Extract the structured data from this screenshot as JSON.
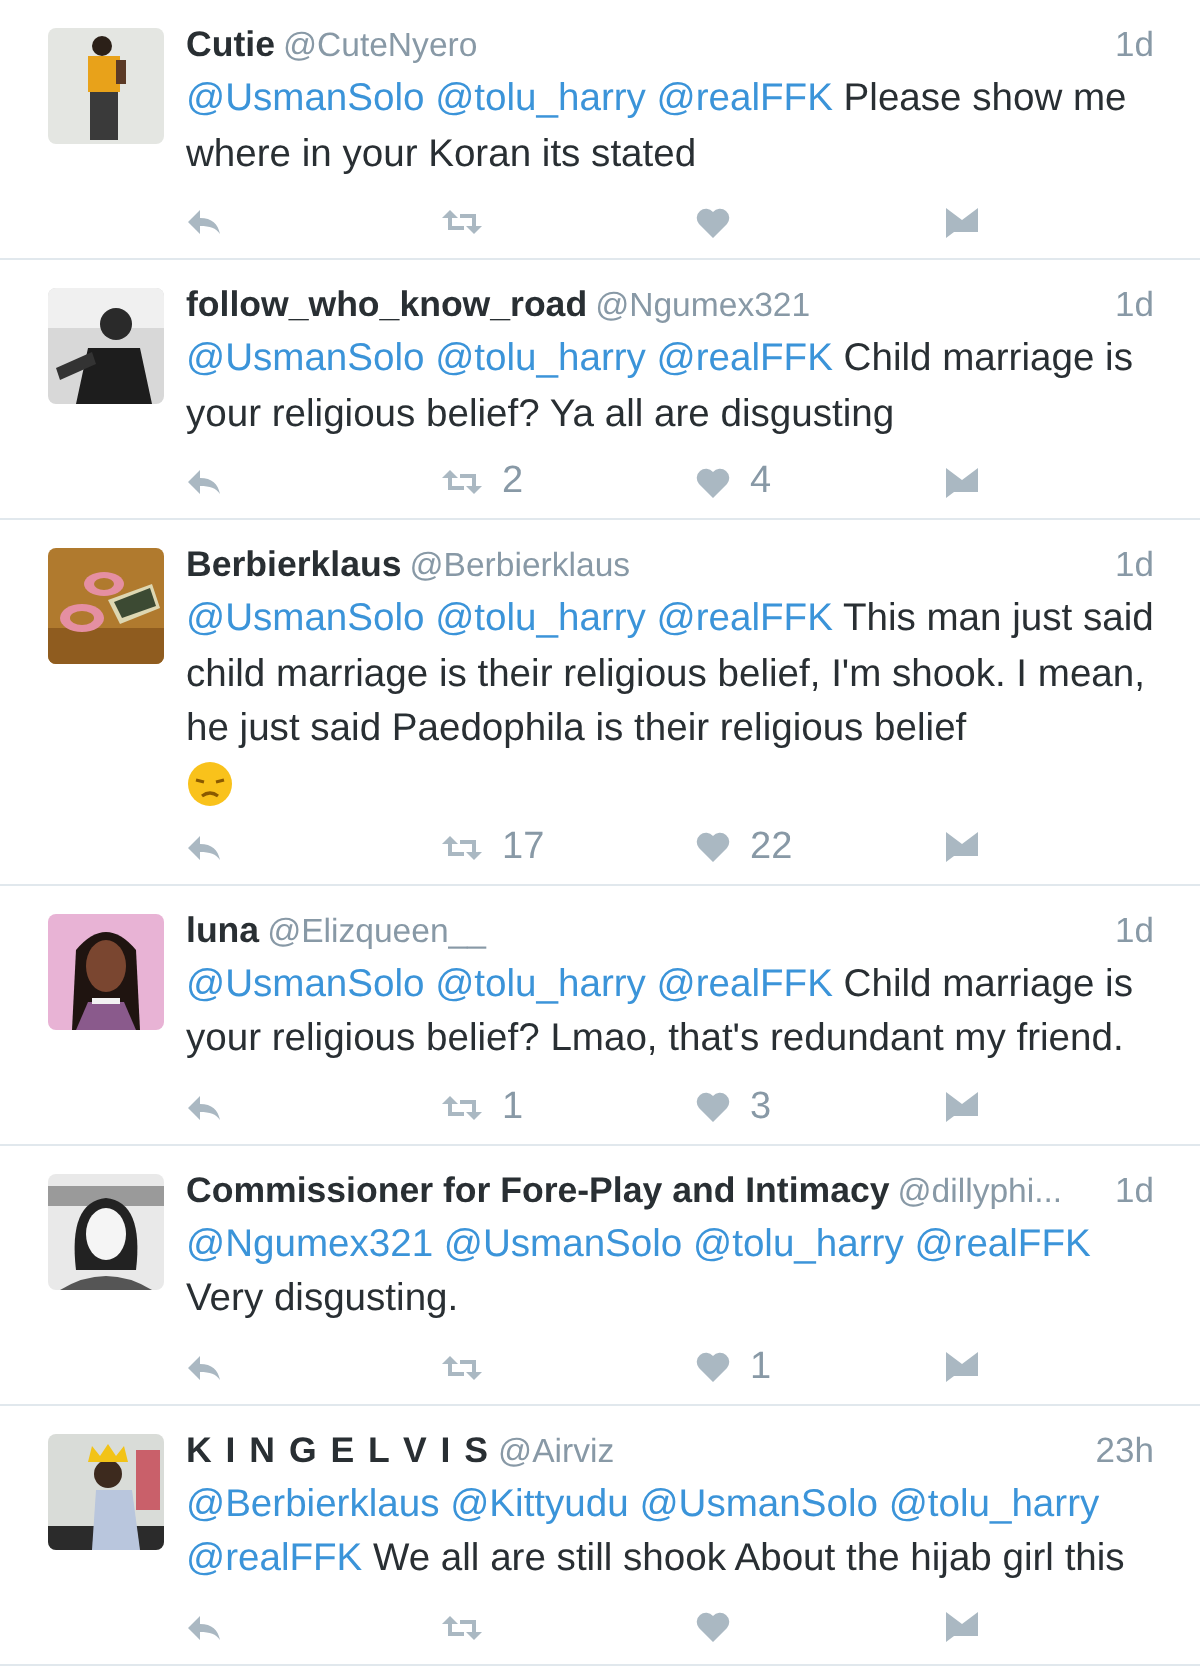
{
  "tweets": [
    {
      "avatar": {
        "kind": "picture"
      },
      "name": "Cutie",
      "handle": "@CuteNyero",
      "time": "1d",
      "mentions": [
        "@UsmanSolo",
        "@tolu_harry",
        "@realFFK"
      ],
      "text": "Please show me where in your Koran its stated",
      "emoji": false
    },
    {
      "avatar": {
        "kind": "picture"
      },
      "name": "follow_who_know_road",
      "handle": "@Ngumex321",
      "time": "1d",
      "mentions": [
        "@UsmanSolo",
        "@tolu_harry",
        "@realFFK"
      ],
      "text": "Child marriage is your religious belief?  Ya all are disgusting",
      "emoji": false,
      "retweets": "2",
      "likes": "4"
    },
    {
      "avatar": {
        "kind": "picture"
      },
      "name": "Berbierklaus",
      "handle": "@Berbierklaus",
      "time": "1d",
      "mentions": [
        "@UsmanSolo",
        "@tolu_harry",
        "@realFFK"
      ],
      "text": "This man just said child marriage is their religious belief, I'm  shook. I mean, he just said Paedophila is their religious belief",
      "emoji": true,
      "retweets": "17",
      "likes": "22"
    },
    {
      "avatar": {
        "kind": "picture"
      },
      "name": "luna",
      "handle": "@Elizqueen__",
      "time": "1d",
      "mentions": [
        "@UsmanSolo",
        "@tolu_harry",
        "@realFFK"
      ],
      "text": "Child marriage is your religious belief? Lmao, that's redundant my friend.",
      "emoji": false,
      "retweets": "1",
      "likes": "3"
    },
    {
      "avatar": {
        "kind": "picture"
      },
      "name": "Commissioner for Fore-Play and Intimacy",
      "handle": "@dillyphi...",
      "time": "1d",
      "mentions": [
        "@Ngumex321",
        "@UsmanSolo",
        "@tolu_harry",
        "@realFFK"
      ],
      "text": "Very disgusting.",
      "emoji": false,
      "likes": "1"
    },
    {
      "avatar": {
        "kind": "picture"
      },
      "name": "K I N G  E L V I S",
      "handle": "@Airviz",
      "time": "23h",
      "mentions": [
        "@Berbierklaus",
        "@Kittyudu",
        "@UsmanSolo",
        "@tolu_harry",
        "@realFFK"
      ],
      "text": "We all are still shook About the hijab girl this",
      "emoji": false
    }
  ]
}
